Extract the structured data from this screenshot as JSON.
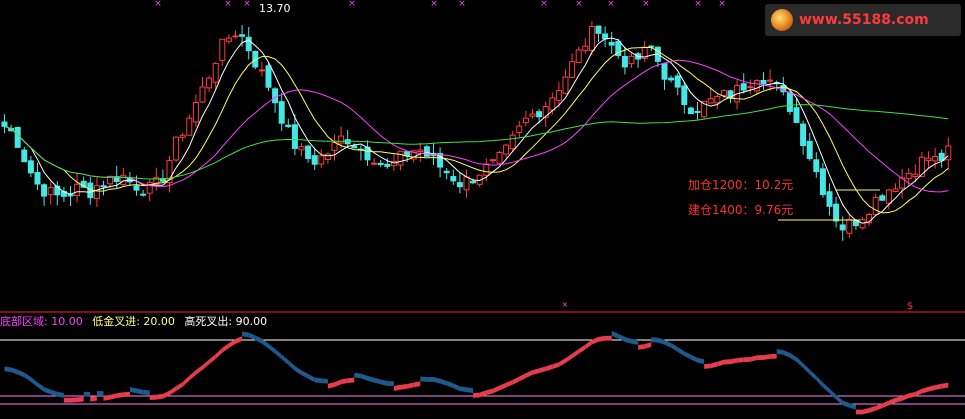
{
  "watermark": {
    "text": "www.55188.com"
  },
  "main_panel": {
    "price_high_label": "13.70",
    "annotations": [
      {
        "text": "加仓1200：10.2元",
        "color": "#ff3030",
        "level": 10.2
      },
      {
        "text": "建仓1400：9.76元",
        "color": "#ff3030",
        "level": 9.76
      }
    ]
  },
  "indicator_panel": {
    "header": [
      {
        "text": "底部区域: 10.00",
        "color": "#ff40ff"
      },
      {
        "text": "低金叉进: 20.00",
        "color": "#ffff80"
      },
      {
        "text": "高死叉出: 90.00",
        "color": "#ffffff"
      }
    ]
  },
  "colors": {
    "up": "#ff3b3b",
    "down": "#44e6e6",
    "ma_short": "#ffffff",
    "ma_mid": "#ffff60",
    "ma_long": "#ff40ff",
    "ma_xlong": "#40e040",
    "osc_up": "#e63c4c",
    "osc_down": "#1e5a8c",
    "grid_line": "#ff2020",
    "ref_line": "#ff80ff"
  },
  "chart_data": {
    "type": "candlestick",
    "y_range": [
      8.2,
      14.0
    ],
    "series_anchor_closes": [
      11.3,
      11.1,
      10.5,
      10.0,
      9.8,
      9.7,
      9.75,
      9.9,
      9.8,
      10.0,
      10.1,
      10.2,
      10.0,
      9.9,
      9.85,
      10.2,
      10.8,
      11.3,
      11.8,
      12.3,
      12.9,
      13.3,
      13.5,
      13.1,
      12.6,
      12.2,
      11.6,
      11.0,
      10.7,
      10.5,
      10.6,
      10.8,
      11.1,
      10.9,
      10.7,
      10.6,
      10.3,
      10.5,
      10.7,
      10.8,
      10.6,
      10.4,
      10.2,
      10.0,
      10.1,
      10.3,
      10.4,
      10.6,
      11.0,
      11.4,
      11.6,
      11.8,
      12.1,
      12.5,
      12.9,
      13.3,
      13.6,
      13.2,
      12.9,
      12.7,
      12.9,
      13.1,
      12.6,
      12.2,
      11.9,
      11.7,
      11.8,
      11.9,
      12.0,
      12.1,
      12.3,
      12.5,
      12.4,
      12.1,
      11.8,
      11.2,
      10.6,
      10.0,
      9.4,
      9.0,
      9.1,
      9.3,
      9.6,
      9.8,
      10.0,
      10.2,
      10.4,
      10.6,
      10.5,
      10.7
    ],
    "oscillator_levels": [
      10,
      20,
      90
    ]
  }
}
